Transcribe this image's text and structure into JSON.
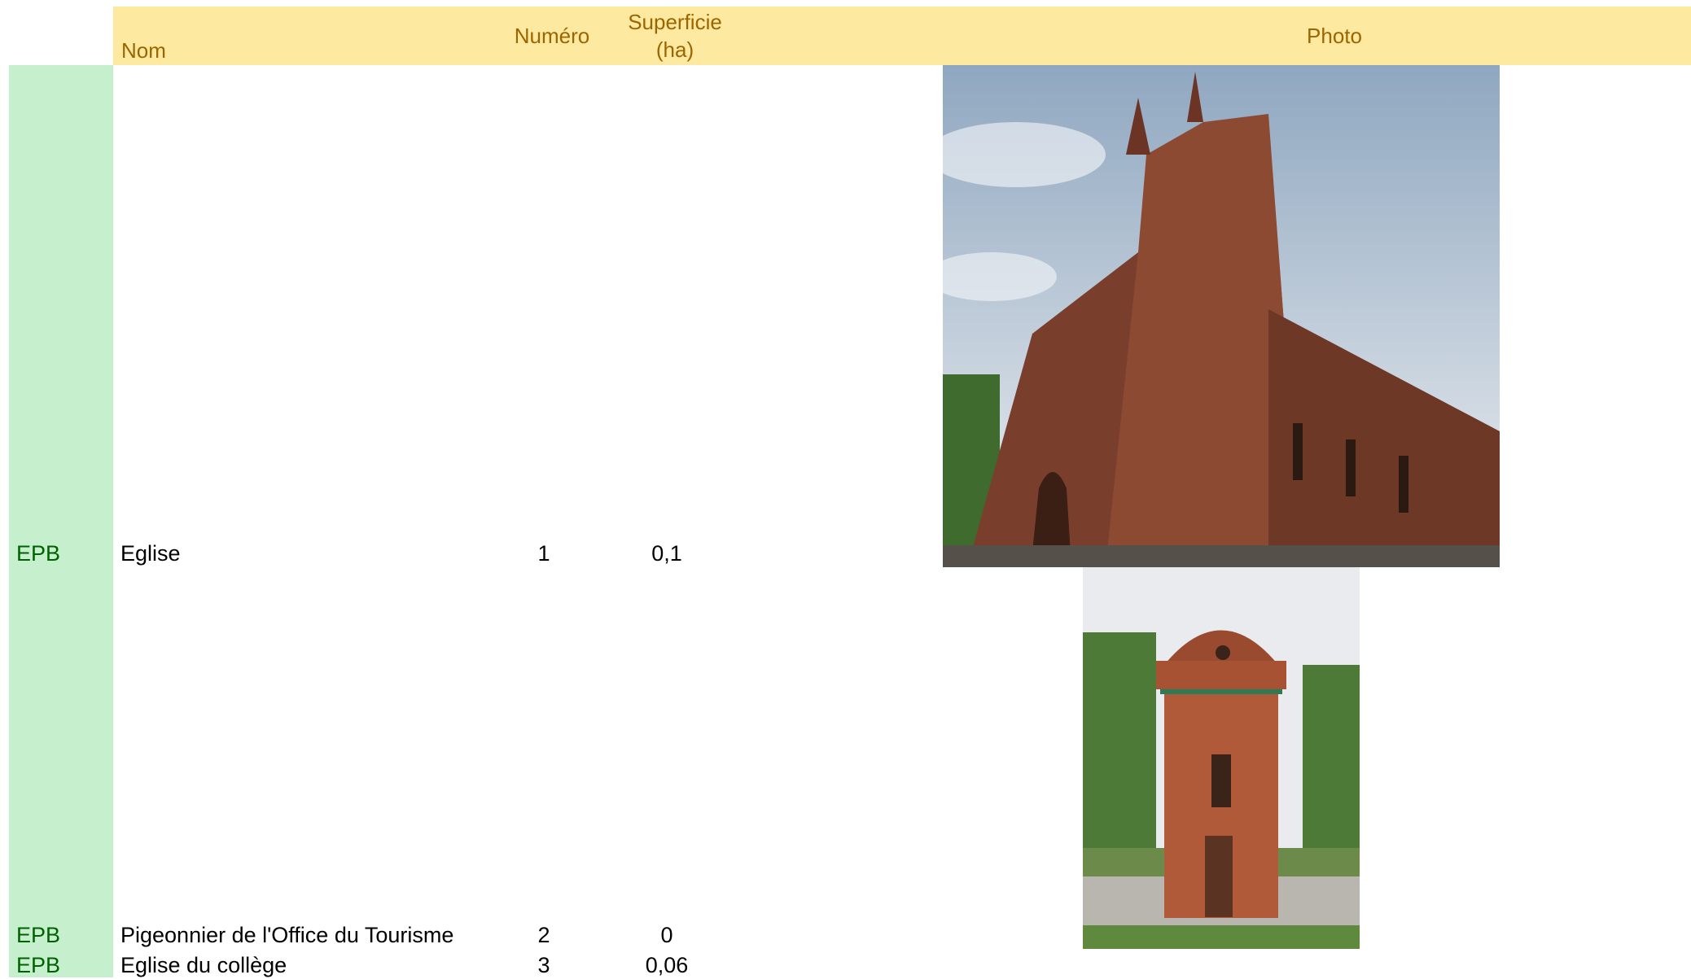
{
  "columns": {
    "nom": "Nom",
    "numero": "Numéro",
    "superficie_line1": "Superficie",
    "superficie_line2": "(ha)",
    "photo": "Photo"
  },
  "rows": [
    {
      "category": "EPB",
      "nom": "Eglise",
      "numero": "1",
      "superficie": "0,1",
      "photo_icon": "church-photo"
    },
    {
      "category": "EPB",
      "nom": "Pigeonnier de l'Office du Tourisme",
      "numero": "2",
      "superficie": "0",
      "photo_icon": "dovecote-photo"
    },
    {
      "category": "EPB",
      "nom": "Eglise du collège",
      "numero": "3",
      "superficie": "0,06"
    }
  ],
  "colors": {
    "header_bg": "#fdeaa0",
    "header_text": "#9c6500",
    "category_bg": "#c6efce",
    "category_text": "#006100"
  }
}
